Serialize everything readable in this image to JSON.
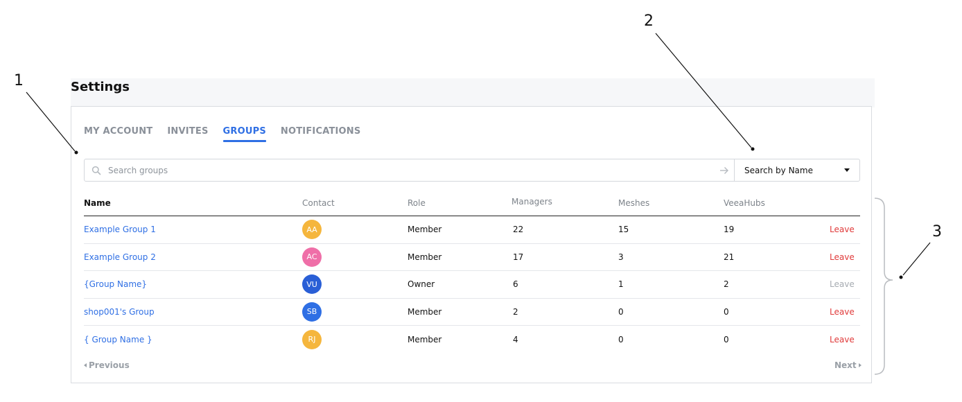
{
  "page": {
    "title": "Settings"
  },
  "tabs": [
    {
      "label": "MY ACCOUNT",
      "active": false
    },
    {
      "label": "INVITES",
      "active": false
    },
    {
      "label": "GROUPS",
      "active": true
    },
    {
      "label": "NOTIFICATIONS",
      "active": false
    }
  ],
  "search": {
    "placeholder": "Search groups",
    "value": "",
    "mode_label": "Search by Name"
  },
  "table": {
    "headers": {
      "name": "Name",
      "contact": "Contact",
      "role": "Role",
      "managers": "Managers",
      "meshes": "Meshes",
      "veeahubs": "VeeaHubs"
    },
    "rows": [
      {
        "name": "Example Group 1",
        "contact_initials": "AA",
        "contact_color": "#f5b63d",
        "role": "Member",
        "managers": "22",
        "meshes": "15",
        "veeahubs": "19",
        "action": "Leave",
        "action_enabled": true
      },
      {
        "name": "Example Group 2",
        "contact_initials": "AC",
        "contact_color": "#ef6fa8",
        "role": "Member",
        "managers": "17",
        "meshes": "3",
        "veeahubs": "21",
        "action": "Leave",
        "action_enabled": true
      },
      {
        "name": "{Group Name}",
        "contact_initials": "VU",
        "contact_color": "#2a5fd6",
        "role": "Owner",
        "managers": "6",
        "meshes": "1",
        "veeahubs": "2",
        "action": "Leave",
        "action_enabled": false
      },
      {
        "name": "shop001's Group",
        "contact_initials": "SB",
        "contact_color": "#2f6fe4",
        "role": "Member",
        "managers": "2",
        "meshes": "0",
        "veeahubs": "0",
        "action": "Leave",
        "action_enabled": true
      },
      {
        "name": "{ Group Name }",
        "contact_initials": "RJ",
        "contact_color": "#f5b63d",
        "role": "Member",
        "managers": "4",
        "meshes": "0",
        "veeahubs": "0",
        "action": "Leave",
        "action_enabled": true
      }
    ]
  },
  "pagination": {
    "previous_label": "Previous",
    "next_label": "Next"
  },
  "callouts": [
    "1",
    "2",
    "3"
  ],
  "colors": {
    "accent": "#2f6fe4",
    "danger": "#e03a3a",
    "muted": "#8a9099"
  },
  "icons": {
    "search": "search-icon",
    "submit": "arrow-right-icon",
    "dropdown": "caret-down-icon"
  }
}
